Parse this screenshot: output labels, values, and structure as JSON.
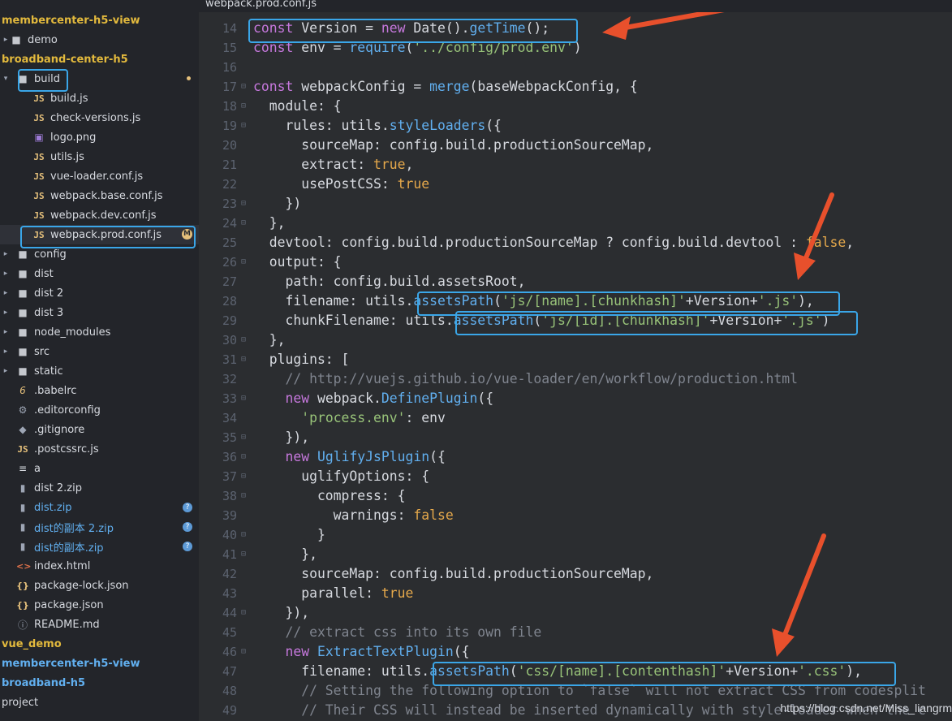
{
  "tab": {
    "title": "webpack.prod.conf.js"
  },
  "tree": [
    {
      "label": "membercenter-h5-view",
      "style": "proj",
      "icon": "none",
      "indent": 0,
      "disc": "none"
    },
    {
      "label": "demo",
      "style": "dim",
      "icon": "folder",
      "indent": 0,
      "disc": "right"
    },
    {
      "label": "broadband-center-h5",
      "style": "proj",
      "icon": "none",
      "indent": 0,
      "disc": "none"
    },
    {
      "label": "build",
      "style": "dim",
      "icon": "folder",
      "indent": 1,
      "disc": "down"
    },
    {
      "label": "build.js",
      "style": "dim",
      "icon": "js",
      "indent": 2,
      "disc": "none"
    },
    {
      "label": "check-versions.js",
      "style": "dim",
      "icon": "js",
      "indent": 2,
      "disc": "none"
    },
    {
      "label": "logo.png",
      "style": "dim",
      "icon": "img",
      "indent": 2,
      "disc": "none"
    },
    {
      "label": "utils.js",
      "style": "dim",
      "icon": "js",
      "indent": 2,
      "disc": "none"
    },
    {
      "label": "vue-loader.conf.js",
      "style": "dim",
      "icon": "js",
      "indent": 2,
      "disc": "none"
    },
    {
      "label": "webpack.base.conf.js",
      "style": "dim",
      "icon": "js",
      "indent": 2,
      "disc": "none"
    },
    {
      "label": "webpack.dev.conf.js",
      "style": "dim",
      "icon": "js",
      "indent": 2,
      "disc": "none"
    },
    {
      "label": "webpack.prod.conf.js",
      "style": "dim",
      "icon": "js",
      "indent": 2,
      "disc": "none"
    },
    {
      "label": "config",
      "style": "dim",
      "icon": "folder",
      "indent": 1,
      "disc": "right"
    },
    {
      "label": "dist",
      "style": "dim",
      "icon": "folder",
      "indent": 1,
      "disc": "right"
    },
    {
      "label": "dist 2",
      "style": "dim",
      "icon": "folder",
      "indent": 1,
      "disc": "right"
    },
    {
      "label": "dist 3",
      "style": "dim",
      "icon": "folder",
      "indent": 1,
      "disc": "right"
    },
    {
      "label": "node_modules",
      "style": "dim",
      "icon": "folder",
      "indent": 1,
      "disc": "right"
    },
    {
      "label": "src",
      "style": "dim",
      "icon": "folder",
      "indent": 1,
      "disc": "right"
    },
    {
      "label": "static",
      "style": "dim",
      "icon": "folder",
      "indent": 1,
      "disc": "right"
    },
    {
      "label": ".babelrc",
      "style": "dim",
      "icon": "babel",
      "indent": 1,
      "disc": "none"
    },
    {
      "label": ".editorconfig",
      "style": "dim",
      "icon": "gear",
      "indent": 1,
      "disc": "none"
    },
    {
      "label": ".gitignore",
      "style": "dim",
      "icon": "git",
      "indent": 1,
      "disc": "none"
    },
    {
      "label": ".postcssrc.js",
      "style": "dim",
      "icon": "js",
      "indent": 1,
      "disc": "none"
    },
    {
      "label": "a",
      "style": "dim",
      "icon": "txt",
      "indent": 1,
      "disc": "none"
    },
    {
      "label": "dist 2.zip",
      "style": "dim",
      "icon": "zip",
      "indent": 1,
      "disc": "none"
    },
    {
      "label": "dist.zip",
      "style": "blue",
      "icon": "zip",
      "indent": 1,
      "disc": "none",
      "badge": "?"
    },
    {
      "label": "dist的副本 2.zip",
      "style": "blue",
      "icon": "zip",
      "indent": 1,
      "disc": "none",
      "badge": "?"
    },
    {
      "label": "dist的副本.zip",
      "style": "blue",
      "icon": "zip",
      "indent": 1,
      "disc": "none",
      "badge": "?"
    },
    {
      "label": "index.html",
      "style": "dim",
      "icon": "html",
      "indent": 1,
      "disc": "none"
    },
    {
      "label": "package-lock.json",
      "style": "dim",
      "icon": "json",
      "indent": 1,
      "disc": "none"
    },
    {
      "label": "package.json",
      "style": "dim",
      "icon": "json",
      "indent": 1,
      "disc": "none"
    },
    {
      "label": "README.md",
      "style": "dim",
      "icon": "info",
      "indent": 1,
      "disc": "none"
    },
    {
      "label": "vue_demo",
      "style": "proj",
      "icon": "none",
      "indent": 0,
      "disc": "none"
    },
    {
      "label": "membercenter-h5-view",
      "style": "projblue",
      "icon": "none",
      "indent": 0,
      "disc": "none"
    },
    {
      "label": "broadband-h5",
      "style": "projblue",
      "icon": "none",
      "indent": 0,
      "disc": "none"
    },
    {
      "label": "project",
      "style": "dim",
      "icon": "none",
      "indent": 0,
      "disc": "none"
    }
  ],
  "code": [
    {
      "n": "14",
      "fold": false,
      "segs": [
        [
          "kw",
          "const"
        ],
        [
          "p",
          " Version = "
        ],
        [
          "kw",
          "new"
        ],
        [
          "p",
          " Date()."
        ],
        [
          "fn",
          "getTime"
        ],
        [
          "p",
          "();"
        ]
      ]
    },
    {
      "n": "15",
      "fold": false,
      "segs": [
        [
          "kw",
          "const"
        ],
        [
          "p",
          " env = "
        ],
        [
          "fn",
          "require"
        ],
        [
          "p",
          "("
        ],
        [
          "str",
          "'../config/prod.env'"
        ],
        [
          "p",
          ")"
        ]
      ]
    },
    {
      "n": "16",
      "fold": false,
      "segs": []
    },
    {
      "n": "17",
      "fold": true,
      "segs": [
        [
          "kw",
          "const"
        ],
        [
          "p",
          " webpackConfig = "
        ],
        [
          "fn",
          "merge"
        ],
        [
          "p",
          "(baseWebpackConfig, {"
        ]
      ]
    },
    {
      "n": "18",
      "fold": true,
      "segs": [
        [
          "p",
          "  module: {"
        ]
      ]
    },
    {
      "n": "19",
      "fold": true,
      "segs": [
        [
          "p",
          "    rules: utils."
        ],
        [
          "fn",
          "styleLoaders"
        ],
        [
          "p",
          "({"
        ]
      ]
    },
    {
      "n": "20",
      "fold": false,
      "segs": [
        [
          "p",
          "      sourceMap: config.build.productionSourceMap,"
        ]
      ]
    },
    {
      "n": "21",
      "fold": false,
      "segs": [
        [
          "p",
          "      extract: "
        ],
        [
          "bool",
          "true"
        ],
        [
          "p",
          ","
        ]
      ]
    },
    {
      "n": "22",
      "fold": false,
      "segs": [
        [
          "p",
          "      usePostCSS: "
        ],
        [
          "bool",
          "true"
        ]
      ]
    },
    {
      "n": "23",
      "fold": true,
      "segs": [
        [
          "p",
          "    })"
        ]
      ]
    },
    {
      "n": "24",
      "fold": true,
      "segs": [
        [
          "p",
          "  },"
        ]
      ]
    },
    {
      "n": "25",
      "fold": false,
      "segs": [
        [
          "p",
          "  devtool: config.build.productionSourceMap ? config.build.devtool : "
        ],
        [
          "bool",
          "false"
        ],
        [
          "p",
          ","
        ]
      ]
    },
    {
      "n": "26",
      "fold": true,
      "segs": [
        [
          "p",
          "  output: {"
        ]
      ]
    },
    {
      "n": "27",
      "fold": false,
      "segs": [
        [
          "p",
          "    path: config.build.assetsRoot,"
        ]
      ]
    },
    {
      "n": "28",
      "fold": false,
      "segs": [
        [
          "p",
          "    filename: utils."
        ],
        [
          "fn",
          "assetsPath"
        ],
        [
          "p",
          "("
        ],
        [
          "str",
          "'js/[name].[chunkhash]'"
        ],
        [
          "p",
          "+Version+"
        ],
        [
          "str",
          "'.js'"
        ],
        [
          "p",
          "),"
        ]
      ]
    },
    {
      "n": "29",
      "fold": false,
      "segs": [
        [
          "p",
          "    chunkFilename: utils."
        ],
        [
          "fn",
          "assetsPath"
        ],
        [
          "p",
          "("
        ],
        [
          "str",
          "'js/[id].[chunkhash]'"
        ],
        [
          "p",
          "+Version+"
        ],
        [
          "str",
          "'.js'"
        ],
        [
          "p",
          ")"
        ]
      ]
    },
    {
      "n": "30",
      "fold": true,
      "segs": [
        [
          "p",
          "  },"
        ]
      ]
    },
    {
      "n": "31",
      "fold": true,
      "segs": [
        [
          "p",
          "  plugins: ["
        ]
      ]
    },
    {
      "n": "32",
      "fold": false,
      "segs": [
        [
          "cm",
          "    // http://vuejs.github.io/vue-loader/en/workflow/production.html"
        ]
      ]
    },
    {
      "n": "33",
      "fold": true,
      "segs": [
        [
          "p",
          "    "
        ],
        [
          "kw",
          "new"
        ],
        [
          "p",
          " webpack."
        ],
        [
          "fn",
          "DefinePlugin"
        ],
        [
          "p",
          "({"
        ]
      ]
    },
    {
      "n": "34",
      "fold": false,
      "segs": [
        [
          "p",
          "      "
        ],
        [
          "str",
          "'process.env'"
        ],
        [
          "p",
          ": env"
        ]
      ]
    },
    {
      "n": "35",
      "fold": true,
      "segs": [
        [
          "p",
          "    }),"
        ]
      ]
    },
    {
      "n": "36",
      "fold": true,
      "segs": [
        [
          "p",
          "    "
        ],
        [
          "kw",
          "new"
        ],
        [
          "p",
          " "
        ],
        [
          "fn",
          "UglifyJsPlugin"
        ],
        [
          "p",
          "({"
        ]
      ]
    },
    {
      "n": "37",
      "fold": true,
      "segs": [
        [
          "p",
          "      uglifyOptions: {"
        ]
      ]
    },
    {
      "n": "38",
      "fold": true,
      "segs": [
        [
          "p",
          "        compress: {"
        ]
      ]
    },
    {
      "n": "39",
      "fold": false,
      "segs": [
        [
          "p",
          "          warnings: "
        ],
        [
          "bool",
          "false"
        ]
      ]
    },
    {
      "n": "40",
      "fold": true,
      "segs": [
        [
          "p",
          "        }"
        ]
      ]
    },
    {
      "n": "41",
      "fold": true,
      "segs": [
        [
          "p",
          "      },"
        ]
      ]
    },
    {
      "n": "42",
      "fold": false,
      "segs": [
        [
          "p",
          "      sourceMap: config.build.productionSourceMap,"
        ]
      ]
    },
    {
      "n": "43",
      "fold": false,
      "segs": [
        [
          "p",
          "      parallel: "
        ],
        [
          "bool",
          "true"
        ]
      ]
    },
    {
      "n": "44",
      "fold": true,
      "segs": [
        [
          "p",
          "    }),"
        ]
      ]
    },
    {
      "n": "45",
      "fold": false,
      "segs": [
        [
          "cm",
          "    // extract css into its own file"
        ]
      ]
    },
    {
      "n": "46",
      "fold": true,
      "segs": [
        [
          "p",
          "    "
        ],
        [
          "kw",
          "new"
        ],
        [
          "p",
          " "
        ],
        [
          "fn",
          "ExtractTextPlugin"
        ],
        [
          "p",
          "({"
        ]
      ]
    },
    {
      "n": "47",
      "fold": false,
      "segs": [
        [
          "p",
          "      filename: utils."
        ],
        [
          "fn",
          "assetsPath"
        ],
        [
          "p",
          "("
        ],
        [
          "str",
          "'css/[name].[contenthash]'"
        ],
        [
          "p",
          "+Version+"
        ],
        [
          "str",
          "'.css'"
        ],
        [
          "p",
          "),"
        ]
      ]
    },
    {
      "n": "48",
      "fold": false,
      "segs": [
        [
          "cm",
          "      // Setting the following option to `false` will not extract CSS from codesplit"
        ]
      ]
    },
    {
      "n": "49",
      "fold": false,
      "segs": [
        [
          "cm",
          "      // Their CSS will instead be inserted dynamically with style-loader when the c"
        ]
      ]
    }
  ],
  "watermark": "https://blog.csdn.net/Miss_liangrm"
}
